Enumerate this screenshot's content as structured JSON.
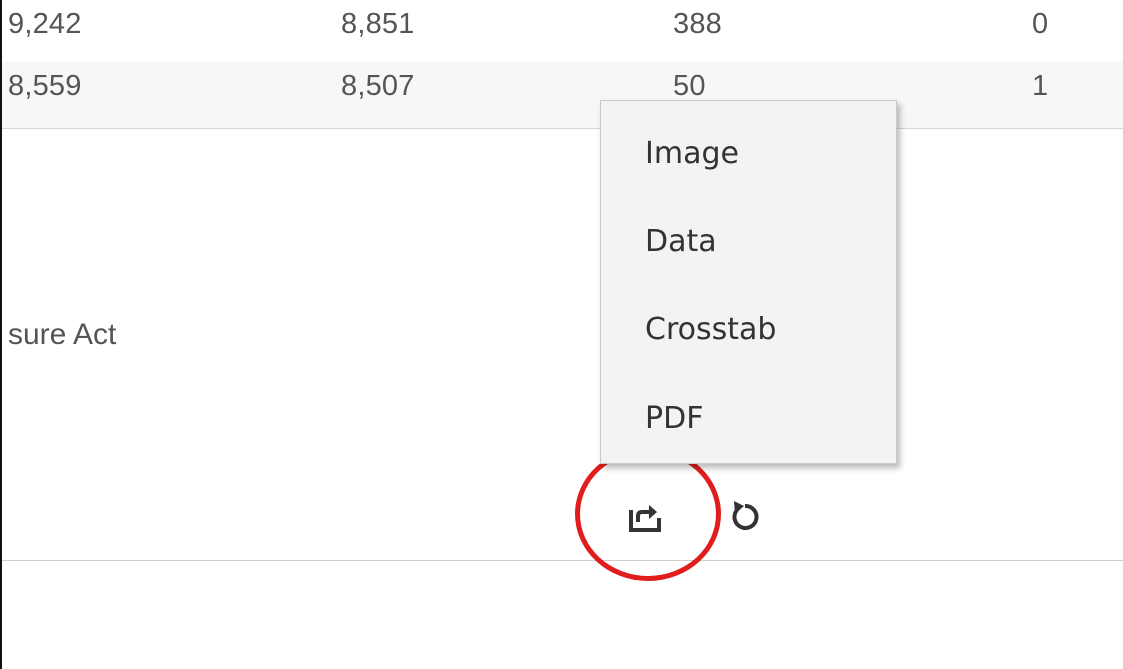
{
  "table": {
    "rows": [
      {
        "c1": "9,242",
        "c2": "8,851",
        "c3": "388",
        "c4": "0"
      },
      {
        "c1": "8,559",
        "c2": "8,507",
        "c3": "50",
        "c4": "1"
      }
    ]
  },
  "partial_label": "sure Act",
  "export_menu": {
    "items": [
      "Image",
      "Data",
      "Crosstab",
      "PDF"
    ]
  },
  "toolbar": {
    "export_icon": "share-export-icon",
    "revert_icon": "revert-icon"
  },
  "colors": {
    "highlight": "#e01c1c",
    "menu_bg": "#f3f3f3",
    "text": "#555555"
  }
}
